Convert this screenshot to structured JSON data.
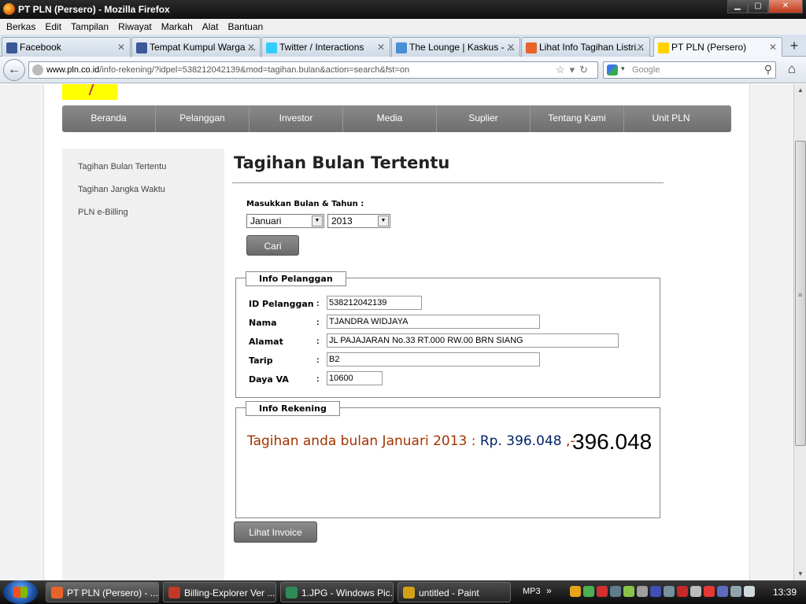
{
  "window": {
    "title": "PT PLN (Persero) - Mozilla Firefox",
    "btn_min": "▁",
    "btn_max": "▢",
    "btn_close": "✕"
  },
  "menu": [
    "Berkas",
    "Edit",
    "Tampilan",
    "Riwayat",
    "Markah",
    "Alat",
    "Bantuan"
  ],
  "tabs": [
    {
      "label": "Facebook",
      "icon_color": "#3b5998",
      "icon": "facebook-icon"
    },
    {
      "label": "Tempat Kumpul Warga ...",
      "icon_color": "#3b5998",
      "icon": "facebook-icon"
    },
    {
      "label": "Twitter / Interactions",
      "icon_color": "#33ccff",
      "icon": "twitter-icon"
    },
    {
      "label": "The Lounge | Kaskus - ...",
      "icon_color": "#4a8fd6",
      "icon": "kaskus-icon"
    },
    {
      "label": "Lihat Info Tagihan Listri...",
      "icon_color": "#e8632a",
      "icon": "blogger-icon"
    },
    {
      "label": "PT PLN (Persero)",
      "icon_color": "#ffd200",
      "icon": "pln-icon"
    }
  ],
  "tab_close": "✕",
  "new_tab": "+",
  "nav": {
    "back": "←",
    "url_domain": "www.pln.co.id",
    "url_path": "/info-rekening/?idpel=538212042139&mod=tagihan.bulan&action=search&fst=on",
    "url_icons": "☆▾↻",
    "search_placeholder": "Google",
    "search_arrow": "▾",
    "search_icon": "⚲",
    "home": "⌂"
  },
  "site_nav": [
    "Beranda",
    "Pelanggan",
    "Investor",
    "Media",
    "Suplier",
    "Tentang Kami",
    "Unit PLN"
  ],
  "sidebar": [
    "Tagihan Bulan Tertentu",
    "Tagihan Jangka Waktu",
    "PLN e-Billing"
  ],
  "content": {
    "heading": "Tagihan Bulan Tertentu",
    "month_year_label": "Masukkan Bulan & Tahun :",
    "month_value": "Januari",
    "year_value": "2013",
    "select_arrow": "▼",
    "search_button": "Cari",
    "info_pelanggan": {
      "legend": "Info Pelanggan",
      "colon": ":",
      "fields": [
        {
          "label": "ID Pelanggan",
          "value": "538212042139"
        },
        {
          "label": "Nama",
          "value": "TJANDRA WIDJAYA"
        },
        {
          "label": "Alamat",
          "value": "JL PAJAJARAN No.33 RT.000 RW.00 BRN SIANG"
        },
        {
          "label": "Tarip",
          "value": "B2"
        },
        {
          "label": "Daya VA",
          "value": "10600"
        }
      ]
    },
    "info_rekening": {
      "legend": "Info Rekening",
      "tagihan_text": "Tagihan anda bulan Januari 2013 : ",
      "rp_text": "Rp. 396.048",
      "suffix": " ,-",
      "big_amount": "396.048"
    },
    "invoice_button": "Lihat Invoice"
  },
  "scrollbar": {
    "up": "▲",
    "down": "▼",
    "grip": "≡"
  },
  "taskbar": {
    "tasks": [
      {
        "label": "PT PLN (Persero) - ...",
        "icon_color": "#e8632a"
      },
      {
        "label": "Billing-Explorer Ver ...",
        "icon_color": "#c0392b"
      },
      {
        "label": "1.JPG - Windows Pic...",
        "icon_color": "#2e8b57"
      },
      {
        "label": "untitled - Paint",
        "icon_color": "#d4a017"
      }
    ],
    "mp3": "MP3",
    "chevron": "»",
    "clock": "13:39"
  }
}
